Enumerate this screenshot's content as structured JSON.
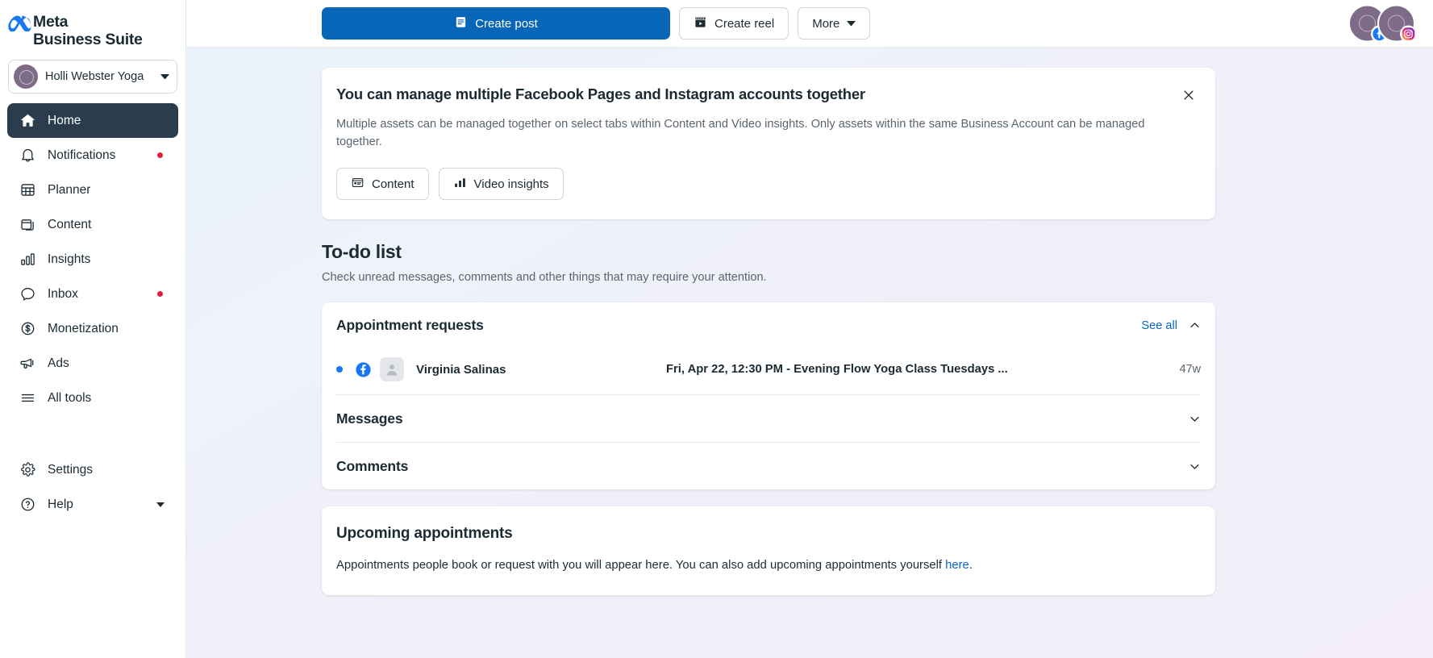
{
  "brand": {
    "name_line1": "Meta",
    "name_line2": "Business Suite",
    "logo_icon": "meta-infinity-icon",
    "logo_color": "#1877f2"
  },
  "account": {
    "name": "Holli Webster Yoga",
    "avatar_icon": "account-avatar",
    "avatar_color": "#7d6b87",
    "chevron_icon": "chevron-down-icon"
  },
  "sidebar": {
    "items": [
      {
        "label": "Home",
        "icon": "home-icon",
        "active": true,
        "badge": false,
        "caret": false
      },
      {
        "label": "Notifications",
        "icon": "bell-icon",
        "active": false,
        "badge": true,
        "caret": false
      },
      {
        "label": "Planner",
        "icon": "calendar-grid-icon",
        "active": false,
        "badge": false,
        "caret": false
      },
      {
        "label": "Content",
        "icon": "cards-stack-icon",
        "active": false,
        "badge": false,
        "caret": false
      },
      {
        "label": "Insights",
        "icon": "bar-chart-icon",
        "active": false,
        "badge": false,
        "caret": false
      },
      {
        "label": "Inbox",
        "icon": "chat-bubble-icon",
        "active": false,
        "badge": true,
        "caret": false
      },
      {
        "label": "Monetization",
        "icon": "dollar-circle-icon",
        "active": false,
        "badge": false,
        "caret": false
      },
      {
        "label": "Ads",
        "icon": "megaphone-icon",
        "active": false,
        "badge": false,
        "caret": false
      },
      {
        "label": "All tools",
        "icon": "hamburger-icon",
        "active": false,
        "badge": false,
        "caret": false
      }
    ],
    "footer_items": [
      {
        "label": "Settings",
        "icon": "gear-icon",
        "caret": false
      },
      {
        "label": "Help",
        "icon": "question-circle-icon",
        "caret": true
      }
    ],
    "badge_color": "#e41e3f",
    "active_bg": "#2b3d4d"
  },
  "toolbar": {
    "create_post_label": "Create post",
    "create_post_icon": "post-document-icon",
    "create_post_color": "#0866b8",
    "create_reel_label": "Create reel",
    "create_reel_icon": "film-clapper-icon",
    "more_label": "More",
    "more_icon": "chevron-down-icon",
    "avatars": [
      {
        "platform_icon": "facebook-icon",
        "platform_color": "#1877f2"
      },
      {
        "platform_icon": "instagram-icon",
        "platform_color": "#e1306c"
      }
    ]
  },
  "banner": {
    "title": "You can manage multiple Facebook Pages and Instagram accounts together",
    "body": "Multiple assets can be managed together on select tabs within Content and Video insights. Only assets within the same Business Account can be managed together.",
    "close_icon": "close-icon",
    "actions": [
      {
        "label": "Content",
        "icon": "content-card-icon"
      },
      {
        "label": "Video insights",
        "icon": "bar-chart-icon"
      }
    ]
  },
  "todo": {
    "title": "To-do list",
    "subtitle": "Check unread messages, comments and other things that may require your attention.",
    "sections": [
      {
        "title": "Appointment requests",
        "see_all_label": "See all",
        "see_all_color": "#0a66c2",
        "chevron_icon": "chevron-up-icon",
        "expanded": true,
        "rows": [
          {
            "unread": true,
            "unread_color": "#1877f2",
            "platform_icon": "facebook-icon",
            "avatar_icon": "person-placeholder-icon",
            "name": "Virginia Salinas",
            "detail": "Fri, Apr 22, 12:30 PM - Evening Flow Yoga Class Tuesdays ...",
            "time": "47w"
          }
        ]
      },
      {
        "title": "Messages",
        "chevron_icon": "chevron-down-icon",
        "expanded": false,
        "rows": []
      },
      {
        "title": "Comments",
        "chevron_icon": "chevron-down-icon",
        "expanded": false,
        "rows": []
      }
    ]
  },
  "upcoming": {
    "title": "Upcoming appointments",
    "body_before": "Appointments people book or request with you will appear here. You can also add upcoming appointments yourself ",
    "link_label": "here",
    "body_after": "."
  }
}
